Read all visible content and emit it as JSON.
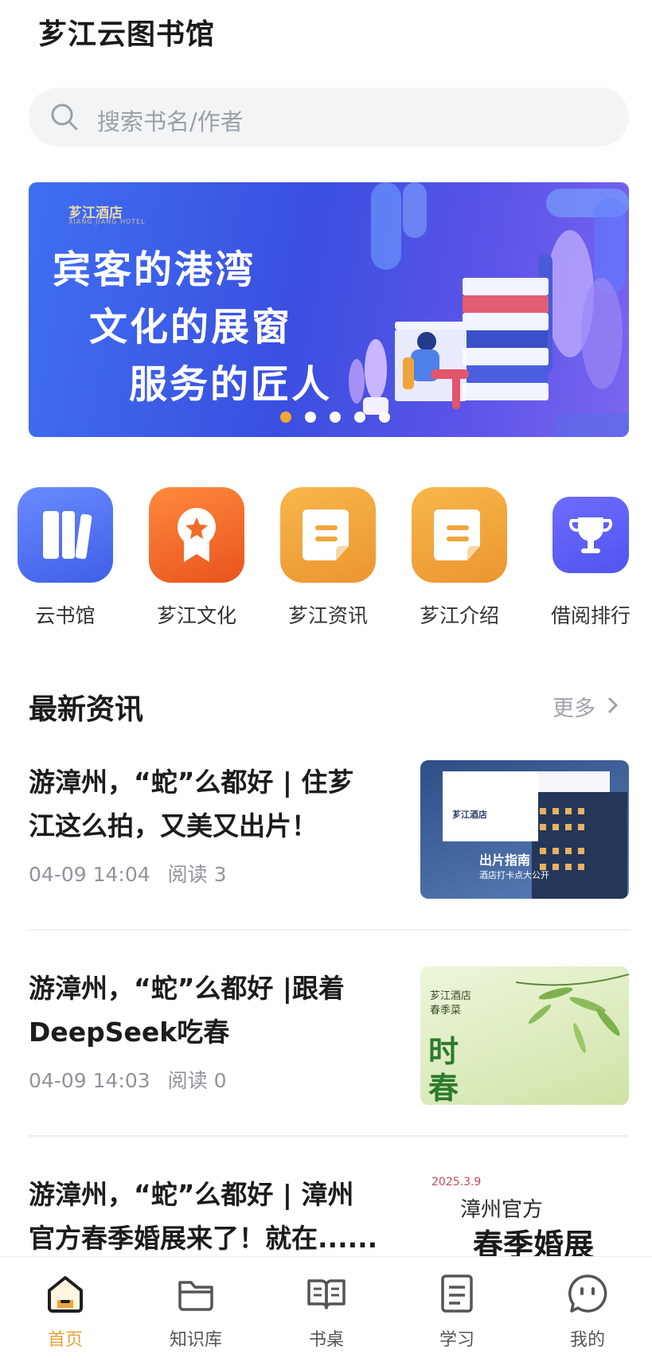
{
  "app": {
    "title": "芗江云图书馆"
  },
  "search": {
    "placeholder": "搜索书名/作者",
    "icon": "search-icon"
  },
  "banner": {
    "brand": "芗江酒店",
    "brand_sub": "XIANG JIANG HOTEL",
    "lines": [
      "宾客的港湾",
      "文化的展窗",
      "服务的匠人"
    ],
    "page_count": 5,
    "active_page": 1,
    "colors": {
      "background": "#3f5ff0",
      "dot_active": "#f3a634"
    }
  },
  "shortcuts": [
    {
      "label": "云书馆",
      "icon": "bookshelf-icon",
      "color": "#4f6ef0"
    },
    {
      "label": "芗江文化",
      "icon": "award-icon",
      "color": "#f06b2a"
    },
    {
      "label": "芗江资讯",
      "icon": "document-icon",
      "color": "#f0a53a"
    },
    {
      "label": "芗江介绍",
      "icon": "document-icon",
      "color": "#f0a53a"
    },
    {
      "label": "借阅排行",
      "icon": "trophy-icon",
      "color": "#5b5ff2"
    }
  ],
  "news_section": {
    "title": "最新资讯",
    "more_label": "更多"
  },
  "news": [
    {
      "title": "游漳州，“蛇”么都好 | 住芗江这么拍，又美又出片！",
      "time": "04-09 14:04",
      "reads": "阅读 3",
      "thumb": {
        "caption_top": "芗江酒店",
        "caption": "出片指南",
        "caption_sub": "酒店打卡点大公开"
      }
    },
    {
      "title": "游漳州，“蛇”么都好 |跟着DeepSeek吃春",
      "time": "04-09 14:03",
      "reads": "阅读 0",
      "thumb": {
        "caption_top": "芗江酒店",
        "caption_top2": "春季菜",
        "caption": "时春食"
      }
    },
    {
      "title": "游漳州，“蛇”么都好 | 漳州官方春季婚展来了！就在......",
      "time": "",
      "reads": "",
      "thumb": {
        "date": "2025.3.9",
        "caption_top": "漳州官方",
        "caption": "春季婚展"
      }
    }
  ],
  "tabbar": {
    "items": [
      {
        "label": "首页",
        "icon": "home-icon",
        "active": true
      },
      {
        "label": "知识库",
        "icon": "folder-icon",
        "active": false
      },
      {
        "label": "书桌",
        "icon": "open-book-icon",
        "active": false
      },
      {
        "label": "学习",
        "icon": "notepad-icon",
        "active": false
      },
      {
        "label": "我的",
        "icon": "profile-chat-icon",
        "active": false
      }
    ],
    "active_color": "#e6a33a"
  }
}
